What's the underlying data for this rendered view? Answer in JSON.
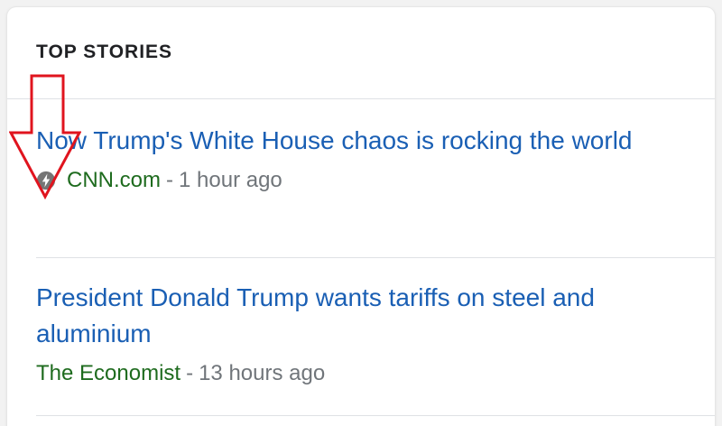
{
  "section": {
    "title": "TOP STORIES"
  },
  "stories": [
    {
      "headline": "Now Trump's White House chaos is rocking the world",
      "source": "CNN.com",
      "separator": "-",
      "time": "1 hour ago",
      "icon": "amp-lightning-icon"
    },
    {
      "headline": "President Donald Trump wants tariffs on steel and aluminium",
      "source": "The Economist",
      "separator": "-",
      "time": "13 hours ago"
    }
  ],
  "annotation": {
    "icon": "down-arrow-icon",
    "color": "#e0141e"
  },
  "colors": {
    "headline": "#1a5fb4",
    "source": "#1e6b1e",
    "meta": "#70757a",
    "amp_icon": "#757575"
  }
}
